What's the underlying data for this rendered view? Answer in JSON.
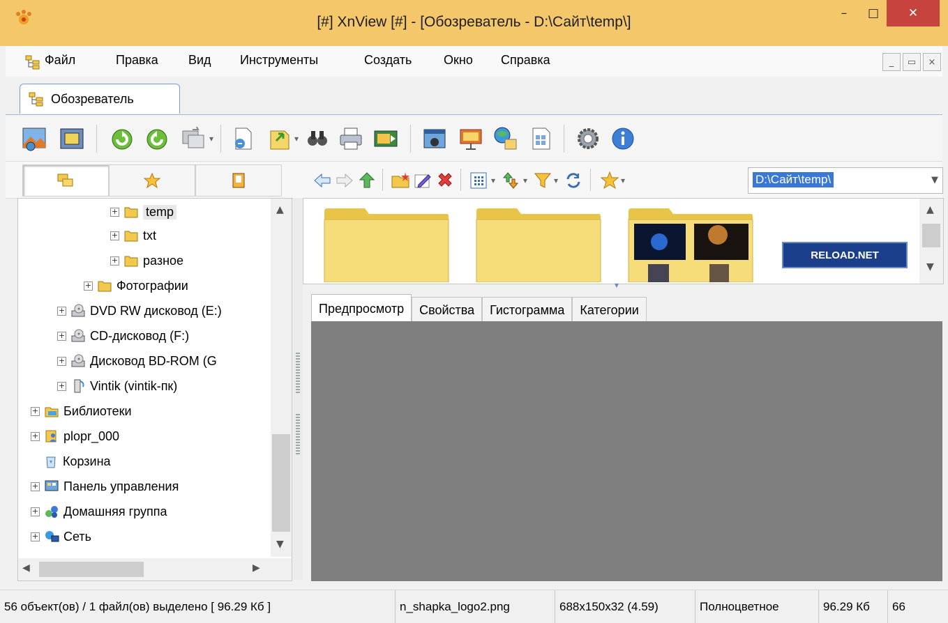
{
  "window": {
    "title": "[#] XnView [#] - [Обозреватель - D:\\Сайт\\temp\\]",
    "controls": {
      "minimize": "–",
      "maximize": "□",
      "close": "✕"
    }
  },
  "menu": {
    "items": [
      "Файл",
      "Правка",
      "Вид",
      "Инструменты",
      "Создать",
      "Окно",
      "Справка"
    ],
    "mdi": {
      "min": "_",
      "restore": "▭",
      "close": "×"
    }
  },
  "doc_tab": {
    "label": "Обозреватель"
  },
  "toolbar": {
    "icons": [
      "view-image-icon",
      "fullscreen-icon",
      "rotate-left-icon",
      "rotate-right-icon",
      "convert-icon",
      "open-file-icon",
      "export-icon",
      "find-icon",
      "print-icon",
      "slideshow-icon",
      "screen-capture-icon",
      "presentation-icon",
      "web-page-icon",
      "contact-sheet-icon",
      "settings-icon",
      "info-icon"
    ]
  },
  "nav": {
    "panel_tabs": [
      "folders-icon",
      "favorites-icon",
      "categories-icon"
    ],
    "address": "D:\\Сайт\\temp\\"
  },
  "tree": {
    "items": [
      {
        "label": "temp",
        "icon": "folder-icon",
        "selected": true
      },
      {
        "label": "txt",
        "icon": "folder-icon"
      },
      {
        "label": "разное",
        "icon": "folder-icon"
      },
      {
        "label": "Фотографии",
        "icon": "folder-icon"
      },
      {
        "label": "DVD RW дисковод (E:)",
        "icon": "optical-drive-icon"
      },
      {
        "label": "CD-дисковод (F:)",
        "icon": "optical-drive-icon"
      },
      {
        "label": "Дисковод BD-ROM (G",
        "icon": "optical-drive-icon"
      },
      {
        "label": "Vintik (vintik-пк)",
        "icon": "network-pc-icon"
      },
      {
        "label": "Библиотеки",
        "icon": "libraries-icon"
      },
      {
        "label": "plopr_000",
        "icon": "user-folder-icon"
      },
      {
        "label": "Корзина",
        "icon": "recycle-bin-icon"
      },
      {
        "label": "Панель управления",
        "icon": "control-panel-icon"
      },
      {
        "label": "Домашняя группа",
        "icon": "homegroup-icon"
      },
      {
        "label": "Сеть",
        "icon": "network-icon"
      }
    ]
  },
  "thumbnails": {
    "logo_text": "RELOAD.NET"
  },
  "preview_tabs": [
    "Предпросмотр",
    "Свойства",
    "Гистограмма",
    "Категории"
  ],
  "status": {
    "selection": "56 объект(ов) / 1 файл(ов) выделено  [ 96.29 Кб ]",
    "filename": "n_shapka_logo2.png",
    "dimensions": "688x150x32 (4.59)",
    "color_mode": "Полноцветное",
    "size": "96.29 Кб",
    "extra": "66"
  },
  "colors": {
    "titlebar": "#f4c86a",
    "close": "#c7433d",
    "preview_bg": "#7f7f7f",
    "address_highlight": "#3a78d8"
  }
}
